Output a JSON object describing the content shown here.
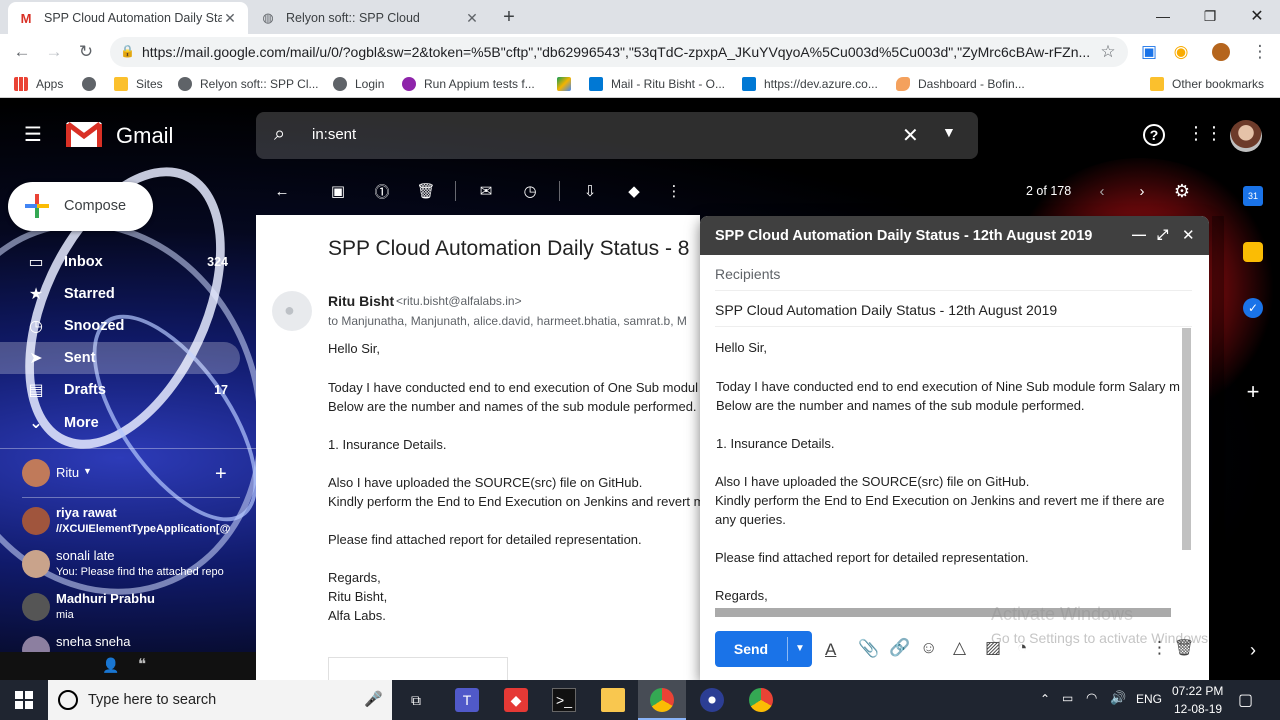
{
  "browser": {
    "tabs": [
      {
        "title": "SPP Cloud Automation Daily Stat",
        "favicon": "M",
        "active": true
      },
      {
        "title": "Relyon soft:: SPP Cloud",
        "favicon": "globe",
        "active": false
      }
    ],
    "url": "https://mail.google.com/mail/u/0/?ogbl&sw=2&token=%5B\"cftp\",\"db62996543\",\"53qTdC-zpxpA_JKuYVqyoA%5Cu003d%5Cu003d\",\"ZyMrc6cBAw-rFZn...",
    "bookmarks": [
      "Apps",
      "Sites",
      "Relyon soft:: SPP Cl...",
      "Login",
      "Run Appium tests f...",
      "Mail - Ritu Bisht - O...",
      "https://dev.azure.co...",
      "Dashboard - Bofin..."
    ],
    "other_bookmarks": "Other bookmarks"
  },
  "gmail": {
    "logo_text": "Gmail",
    "search_value": "in:sent",
    "compose_label": "Compose",
    "nav": [
      {
        "label": "Inbox",
        "count": "324",
        "icon": "inbox-icon"
      },
      {
        "label": "Starred",
        "count": "",
        "icon": "star-icon"
      },
      {
        "label": "Snoozed",
        "count": "",
        "icon": "clock-icon"
      },
      {
        "label": "Sent",
        "count": "",
        "icon": "send-icon"
      },
      {
        "label": "Drafts",
        "count": "17",
        "icon": "draft-icon"
      },
      {
        "label": "More",
        "count": "",
        "icon": "chevron-down-icon"
      }
    ],
    "hangouts_user": "Ritu",
    "chats": [
      {
        "name": "riya rawat",
        "sub": "//XCUIElementTypeApplication[@"
      },
      {
        "name": "sonali late",
        "sub": "You:   Please find the attached repo"
      },
      {
        "name": "Madhuri Prabhu",
        "sub": "mia"
      },
      {
        "name": "sneha sneha",
        "sub": ""
      }
    ],
    "pager": "2 of 178"
  },
  "message": {
    "subject": "SPP Cloud Automation Daily Status - 8",
    "sender_name": "Ritu Bisht",
    "sender_email": "<ritu.bisht@alfalabs.in>",
    "to_line": "to Manjunatha, Manjunath, alice.david, harmeet.bhatia, samrat.b, M",
    "body": [
      "Hello Sir,",
      "Today I have conducted end to end execution of One Sub modul",
      "Below are the number and names of the sub module performed.",
      "1. Insurance Details.",
      "Also I have uploaded the SOURCE(src) file on GitHub.",
      "Kindly perform the End to End Execution on Jenkins and revert m",
      "Please find attached report for detailed representation.",
      "Regards,",
      "Ritu Bisht,",
      "Alfa Labs."
    ]
  },
  "compose": {
    "title": "SPP Cloud Automation Daily Status - 12th August 2019",
    "recipients_placeholder": "Recipients",
    "subject": "SPP Cloud Automation Daily Status - 12th August 2019",
    "body": [
      "Hello Sir,",
      "Today I have conducted end to end execution of Nine Sub module form Salary m",
      "Below are the number and names of the sub module performed.",
      "1. Insurance Details.",
      "Also I have uploaded the SOURCE(src) file on GitHub.",
      "Kindly perform the End to End Execution on Jenkins and revert me if there are",
      "any queries.",
      "Please find attached report for detailed representation.",
      "Regards,"
    ],
    "send_label": "Send",
    "watermark_line1": "Activate Windows",
    "watermark_line2": "Go to Settings to activate Windows."
  },
  "taskbar": {
    "search_placeholder": "Type here to search",
    "language": "ENG",
    "time": "07:22 PM",
    "date": "12-08-19"
  },
  "colors": {
    "gmail_red": "#d93025",
    "send_blue": "#1a73e8",
    "compose_header": "#404040"
  }
}
